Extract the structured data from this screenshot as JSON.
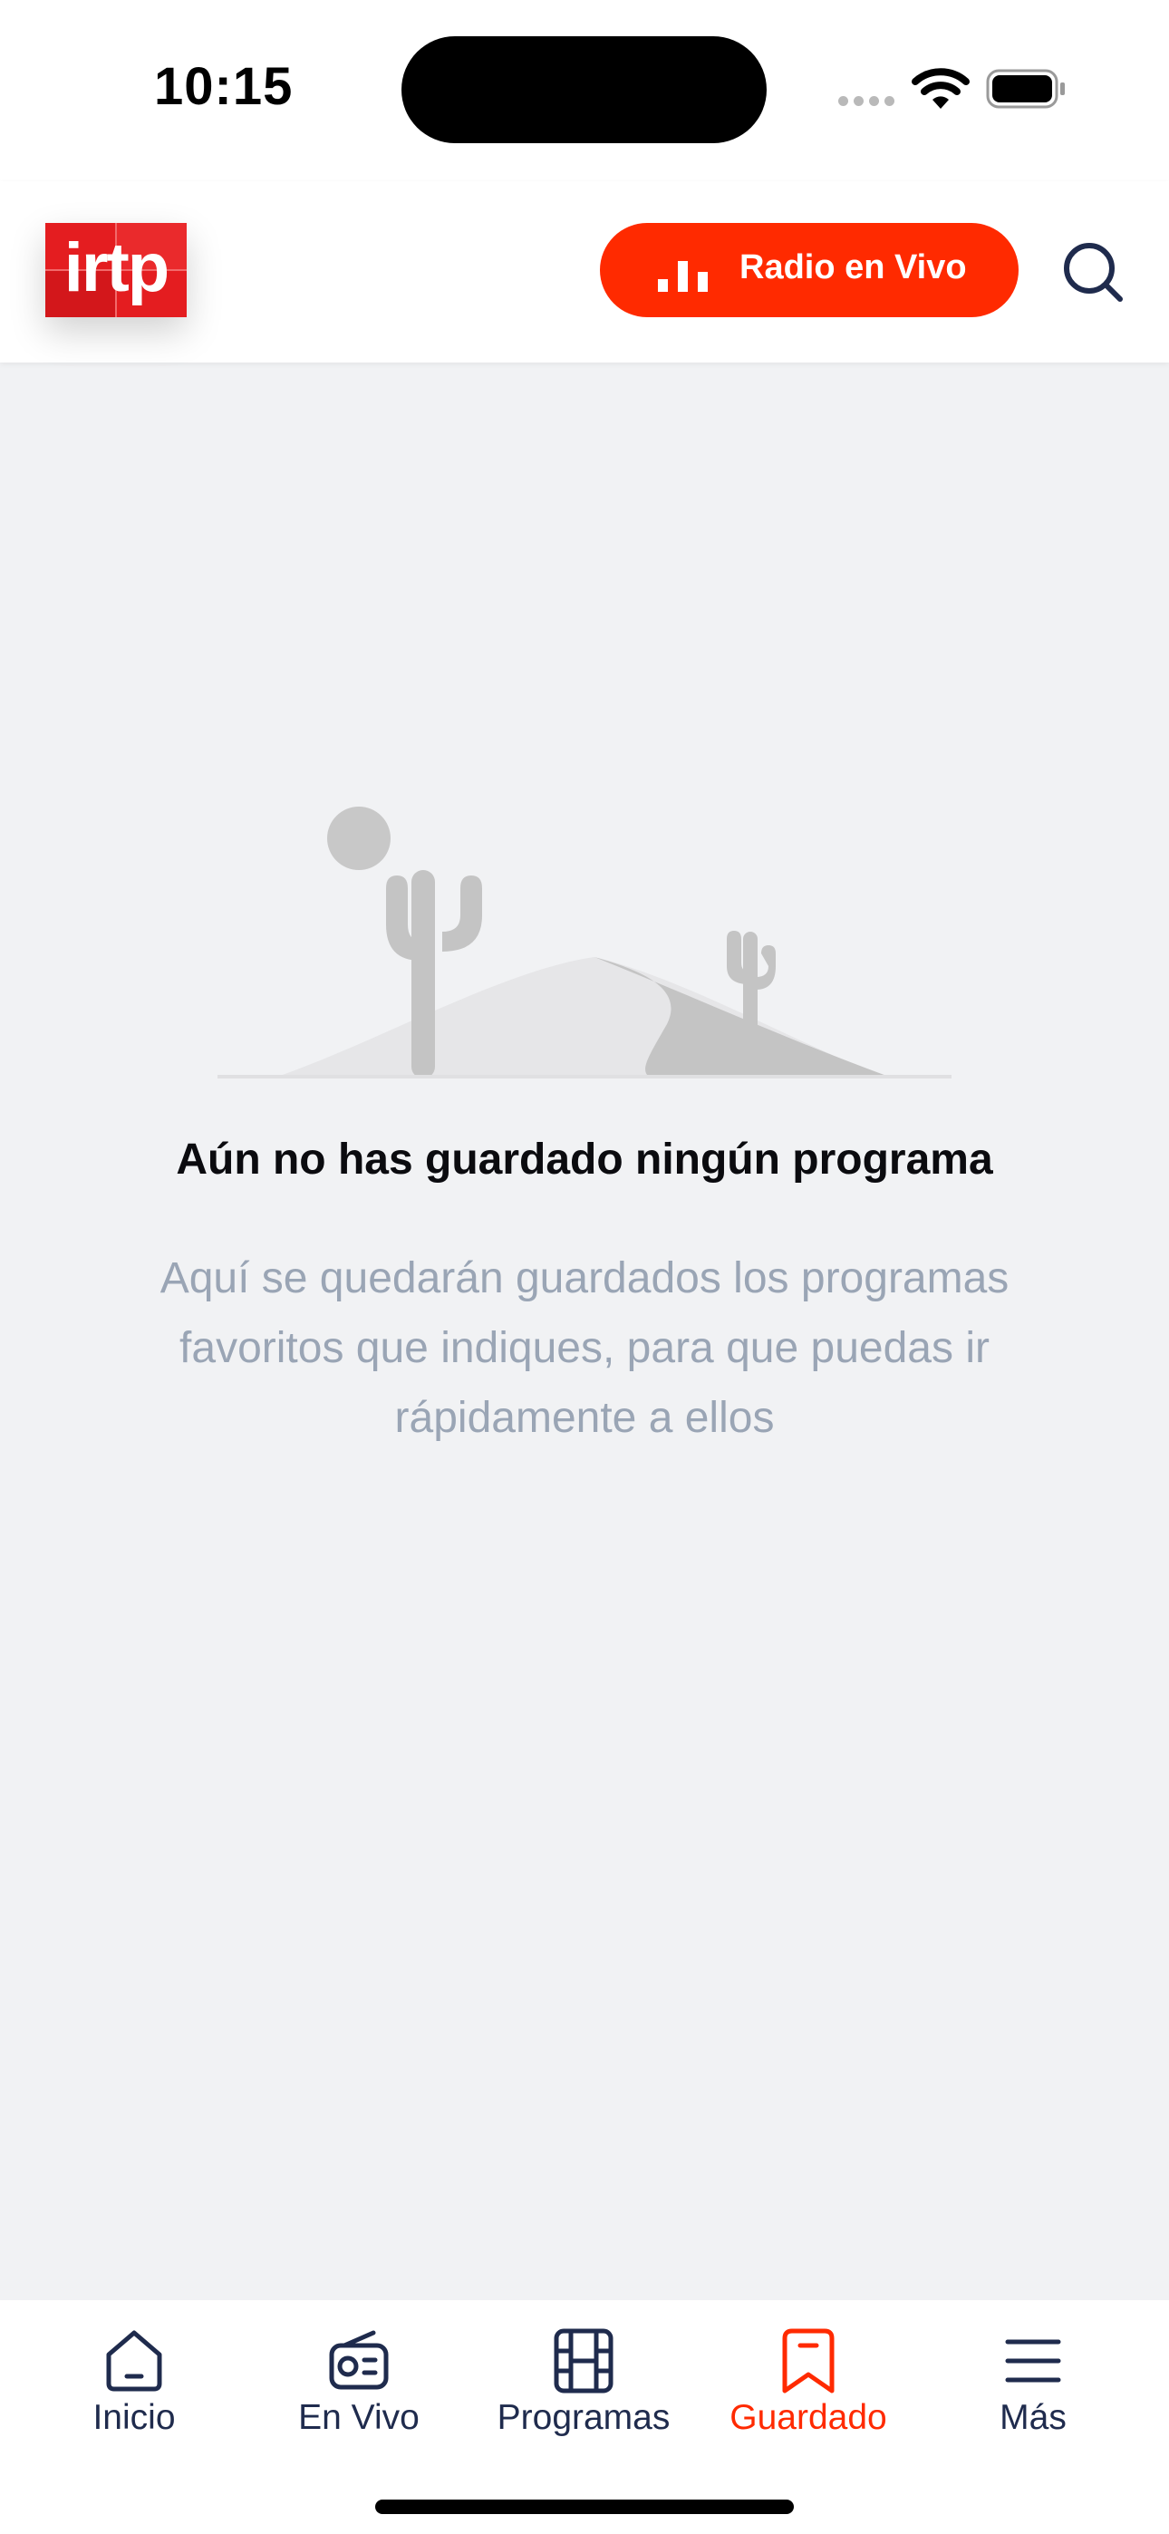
{
  "status_bar": {
    "time": "10:15",
    "icons": [
      "cellular-signal-icon",
      "wifi-icon",
      "battery-icon"
    ]
  },
  "header": {
    "logo_text": "irtp",
    "radio_button_label": "Radio en Vivo",
    "icons": [
      "equalizer-bars-icon",
      "search-icon"
    ]
  },
  "empty_state": {
    "illustration": "desert-cactus-illustration",
    "title": "Aún no has guardado ningún programa",
    "description": "Aquí se quedarán guardados los programas favoritos que indiques, para que puedas ir rápidamente a ellos"
  },
  "tab_bar": {
    "tabs": [
      {
        "label": "Inicio",
        "icon": "home-icon",
        "active": false
      },
      {
        "label": "En Vivo",
        "icon": "radio-icon",
        "active": false
      },
      {
        "label": "Programas",
        "icon": "film-icon",
        "active": false
      },
      {
        "label": "Guardado",
        "icon": "bookmark-icon",
        "active": true
      },
      {
        "label": "Más",
        "icon": "menu-icon",
        "active": false
      }
    ]
  },
  "colors": {
    "accent": "#ff2a00",
    "logo_red": "#e41d20",
    "nav_text": "#1f2b4d",
    "background": "#f1f2f4",
    "muted_text": "#9aa5b5"
  }
}
